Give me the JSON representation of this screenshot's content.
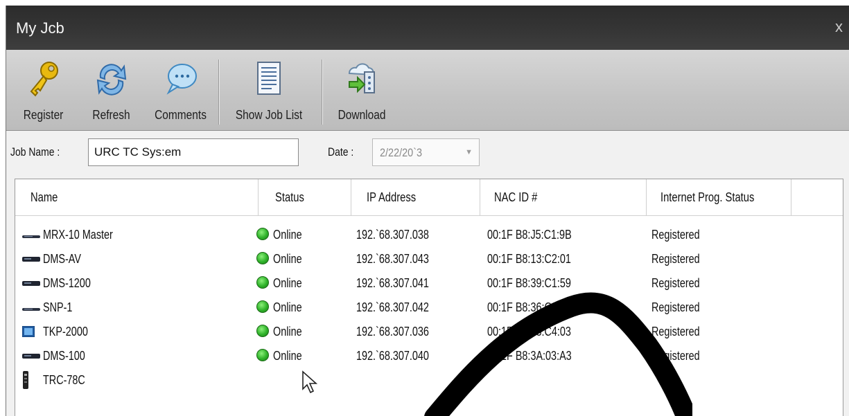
{
  "window": {
    "title": "My Jcb",
    "close_glyph": "x"
  },
  "toolbar": {
    "buttons": [
      {
        "label": "Register",
        "icon": "key-icon"
      },
      {
        "label": "Refresh",
        "icon": "refresh-icon"
      },
      {
        "label": "Comments",
        "icon": "speech-bubble-icon"
      },
      {
        "label": "Show Job List",
        "icon": "document-list-icon"
      },
      {
        "label": "Download",
        "icon": "cloud-download-icon"
      }
    ]
  },
  "job": {
    "name_label": "Job Name :",
    "name_value": "URC TC Sys:em",
    "date_label": "Date :",
    "date_value": "2/22/20`3"
  },
  "table": {
    "columns": [
      "Name",
      "Status",
      "IP Address",
      "NAC ID #",
      "Internet Prog. Status"
    ],
    "rows": [
      {
        "name": "MRX-10 Master",
        "icon": "slim-device-icon",
        "status": "Online",
        "ip": "192.`68.307.038",
        "mac": "00:1F B8:J5:C1:9B",
        "prog": "Registered"
      },
      {
        "name": "DMS-AV",
        "icon": "rack-device-icon",
        "status": "Online",
        "ip": "192.`68.307.043",
        "mac": "00:1F B8:13:C2:01",
        "prog": "Registered"
      },
      {
        "name": "DMS-1200",
        "icon": "rack-device-icon",
        "status": "Online",
        "ip": "192.`68.307.041",
        "mac": "00:1F B8:39:C1:59",
        "prog": "Registered"
      },
      {
        "name": "SNP-1",
        "icon": "slim-device-icon",
        "status": "Online",
        "ip": "192.`68.307.042",
        "mac": "00:1F B8:36:C0:8A",
        "prog": "Registered"
      },
      {
        "name": "TKP-2000",
        "icon": "touch-panel-icon",
        "status": "Online",
        "ip": "192.`68.307.036",
        "mac": "00:1F B8:33:C4:03",
        "prog": "Registered"
      },
      {
        "name": "DMS-100",
        "icon": "rack-device-icon",
        "status": "Online",
        "ip": "192.`68.307.040",
        "mac": "00:1F B8:3A:03:A3",
        "prog": "Registered"
      },
      {
        "name": "TRC-78C",
        "icon": "remote-control-icon",
        "status": "",
        "ip": "",
        "mac": "",
        "prog": ""
      }
    ]
  },
  "colors": {
    "titlebar": "#333333",
    "online": "#2fb22a",
    "stroke": "#000000"
  }
}
